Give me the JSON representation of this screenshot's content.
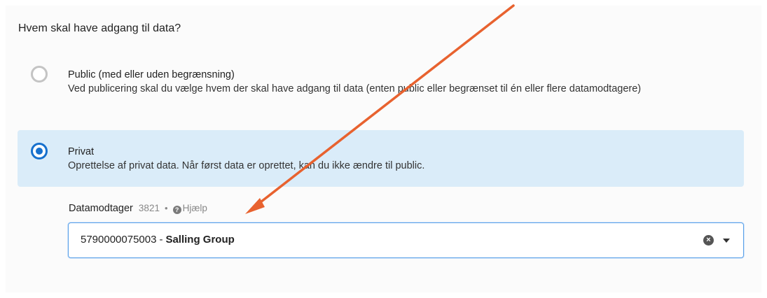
{
  "question": "Hvem skal have adgang til data?",
  "options": [
    {
      "title": "Public (med eller uden begrænsning)",
      "description": "Ved publicering skal du vælge hvem der skal have adgang til data (enten public eller begrænset til én eller flere datamodtagere)",
      "selected": false
    },
    {
      "title": "Privat",
      "description": "Oprettelse af privat data. Når først data er oprettet, kan du ikke ændre til public.",
      "selected": true
    }
  ],
  "field": {
    "label": "Datamodtager",
    "id": "3821",
    "separator": "•",
    "help_label": "Hjælp",
    "selected_code": "5790000075003",
    "selected_separator": "-",
    "selected_name": "Salling Group"
  },
  "icons": {
    "help": "question-circle-icon",
    "clear": "clear-circle-icon",
    "caret": "caret-down-icon"
  },
  "colors": {
    "accent": "#1670cd",
    "selected_bg": "#daecf9",
    "annotation_arrow": "#e8622f"
  }
}
